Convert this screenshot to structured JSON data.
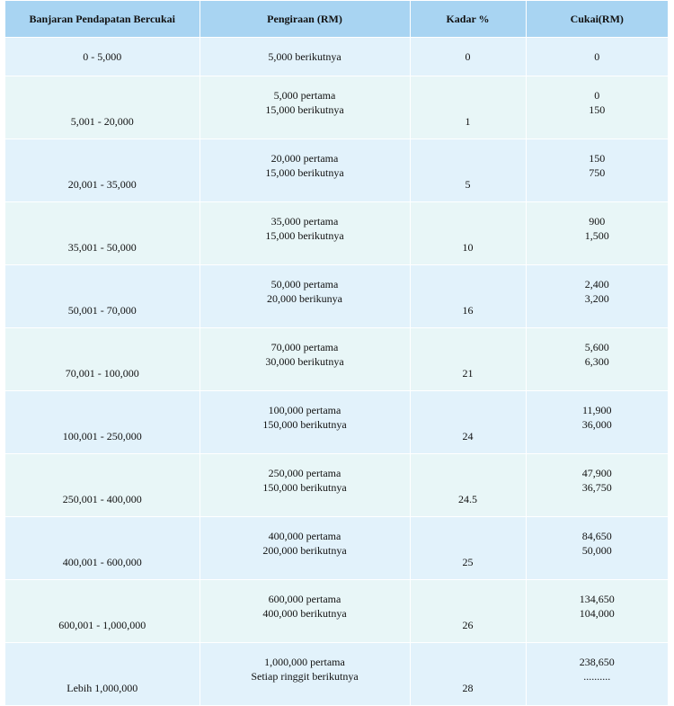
{
  "table": {
    "headers": {
      "range": "Banjaran Pendapatan Bercukai",
      "calculation": "Pengiraan (RM)",
      "rate": "Kadar %",
      "tax": "Cukai(RM)"
    },
    "rows": [
      {
        "range": "0 - 5,000",
        "calc": [
          "5,000 berikutnya"
        ],
        "rate": "0",
        "tax": [
          "0"
        ]
      },
      {
        "range": "5,001 - 20,000",
        "calc": [
          "5,000 pertama",
          "15,000 berikutnya"
        ],
        "rate": "1",
        "tax": [
          "0",
          "150"
        ]
      },
      {
        "range": "20,001 - 35,000",
        "calc": [
          "20,000 pertama",
          "15,000 berikutnya"
        ],
        "rate": "5",
        "tax": [
          "150",
          "750"
        ]
      },
      {
        "range": "35,001 - 50,000",
        "calc": [
          "35,000 pertama",
          "15,000 berikutnya"
        ],
        "rate": "10",
        "tax": [
          "900",
          "1,500"
        ]
      },
      {
        "range": "50,001 - 70,000",
        "calc": [
          "50,000 pertama",
          "20,000 berikunya"
        ],
        "rate": "16",
        "tax": [
          "2,400",
          "3,200"
        ]
      },
      {
        "range": "70,001 - 100,000",
        "calc": [
          "70,000 pertama",
          "30,000 berikutnya"
        ],
        "rate": "21",
        "tax": [
          "5,600",
          "6,300"
        ]
      },
      {
        "range": "100,001 - 250,000",
        "calc": [
          "100,000 pertama",
          "150,000 berikutnya"
        ],
        "rate": "24",
        "tax": [
          "11,900",
          "36,000"
        ]
      },
      {
        "range": "250,001 - 400,000",
        "calc": [
          "250,000 pertama",
          "150,000 berikutnya"
        ],
        "rate": "24.5",
        "tax": [
          "47,900",
          "36,750"
        ]
      },
      {
        "range": "400,001 - 600,000",
        "calc": [
          "400,000 pertama",
          "200,000 berikutnya"
        ],
        "rate": "25",
        "tax": [
          "84,650",
          "50,000"
        ]
      },
      {
        "range": "600,001 - 1,000,000",
        "calc": [
          "600,000 pertama",
          "400,000 berikutnya"
        ],
        "rate": "26",
        "tax": [
          "134,650",
          "104,000"
        ]
      },
      {
        "range": "Lebih 1,000,000",
        "calc": [
          "1,000,000 pertama",
          "Setiap ringgit berikutnya"
        ],
        "rate": "28",
        "tax": [
          "238,650",
          ".........."
        ]
      }
    ]
  }
}
